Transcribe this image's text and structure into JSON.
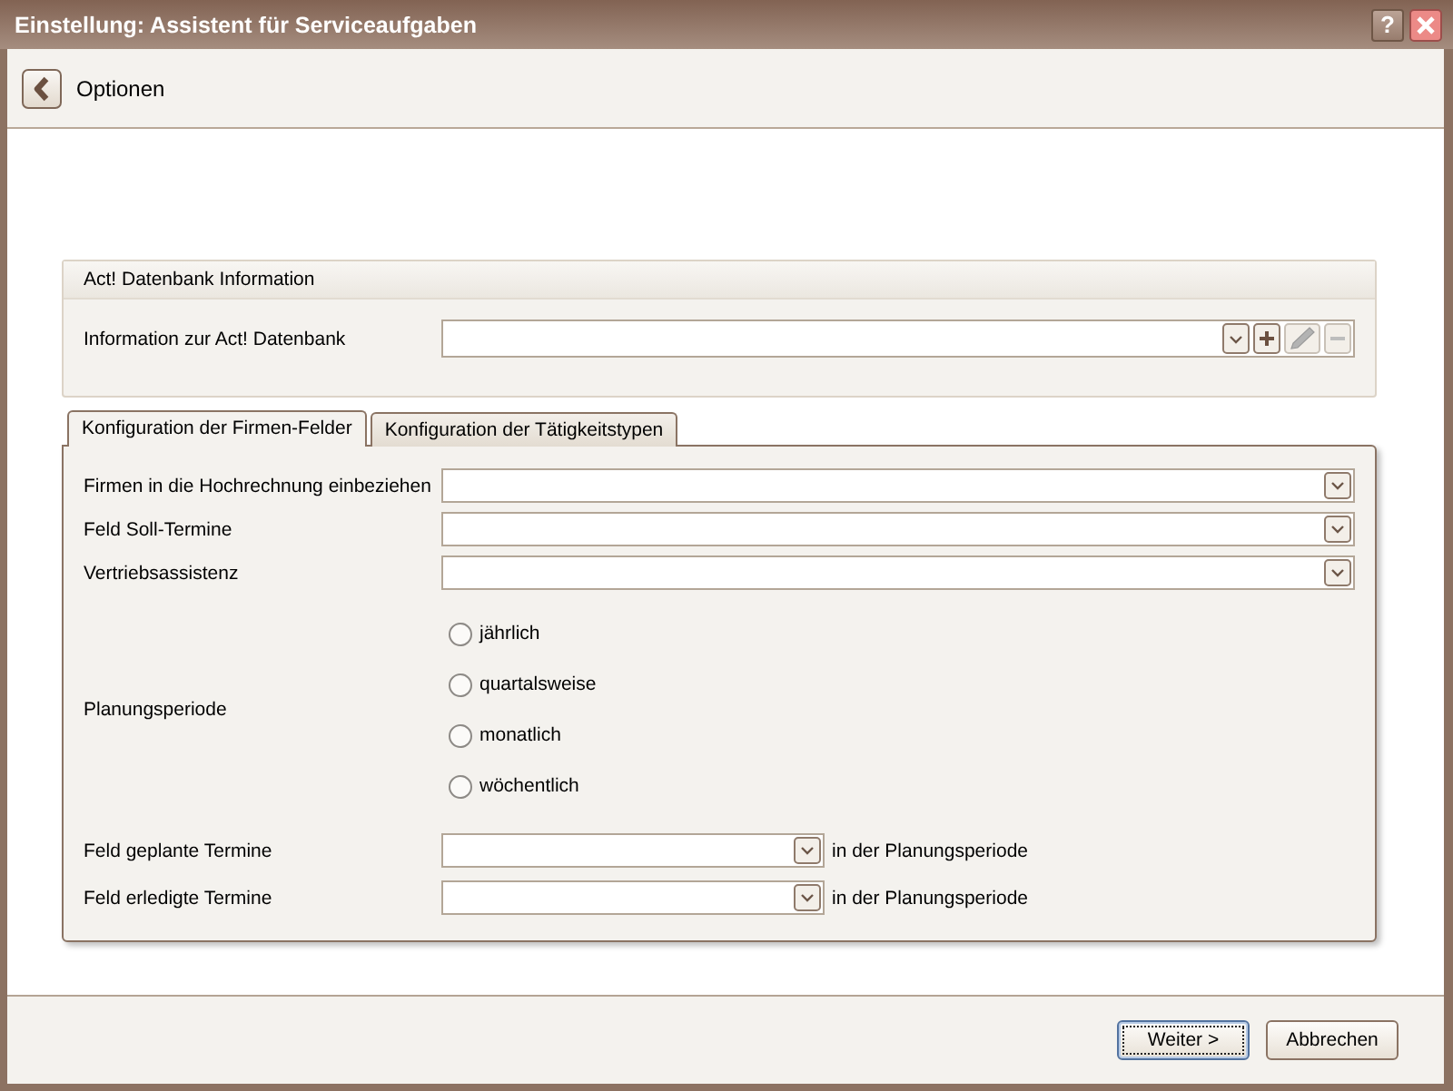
{
  "window": {
    "title": "Einstellung: Assistent für Serviceaufgaben",
    "title_buttons": [
      {
        "kind": "help",
        "label": "?"
      },
      {
        "kind": "close"
      }
    ]
  },
  "header": {
    "title": "Optionen"
  },
  "database_group": {
    "title": "Act! Datenbank Information",
    "label": "Information zur Act! Datenbank",
    "actions": [
      {
        "kind": "add",
        "disabled": false
      },
      {
        "kind": "edit",
        "disabled": true
      },
      {
        "kind": "remove",
        "disabled": true
      }
    ]
  },
  "tabs": [
    {
      "label": "Konfiguration der Firmen-Felder",
      "selected": true
    },
    {
      "label": "Konfiguration der Tätigkeitstypen",
      "selected": false
    }
  ],
  "form": [
    {
      "kind": "dropdown",
      "label": "Firmen in die Hochrechnung einbeziehen"
    },
    {
      "kind": "dropdown",
      "label": "Feld Soll-Termine"
    },
    {
      "kind": "dropdown",
      "label": "Vertriebsassistenz"
    },
    {
      "kind": "radio_group",
      "label": "Planungsperiode",
      "options": [
        {
          "label": "jährlich",
          "selected": false
        },
        {
          "label": "quartalsweise",
          "selected": false
        },
        {
          "label": "monatlich",
          "selected": false
        },
        {
          "label": "wöchentlich",
          "selected": false
        }
      ]
    },
    {
      "kind": "short_dropdown",
      "label": "Feld geplante Termine",
      "suffix": "in der Planungsperiode"
    },
    {
      "kind": "short_dropdown",
      "label": "Feld erledigte Termine",
      "suffix": "in der Planungsperiode"
    }
  ],
  "buttons": [
    {
      "label": "Weiter >",
      "focused": true
    },
    {
      "label": "Abbrechen",
      "focused": false
    }
  ]
}
